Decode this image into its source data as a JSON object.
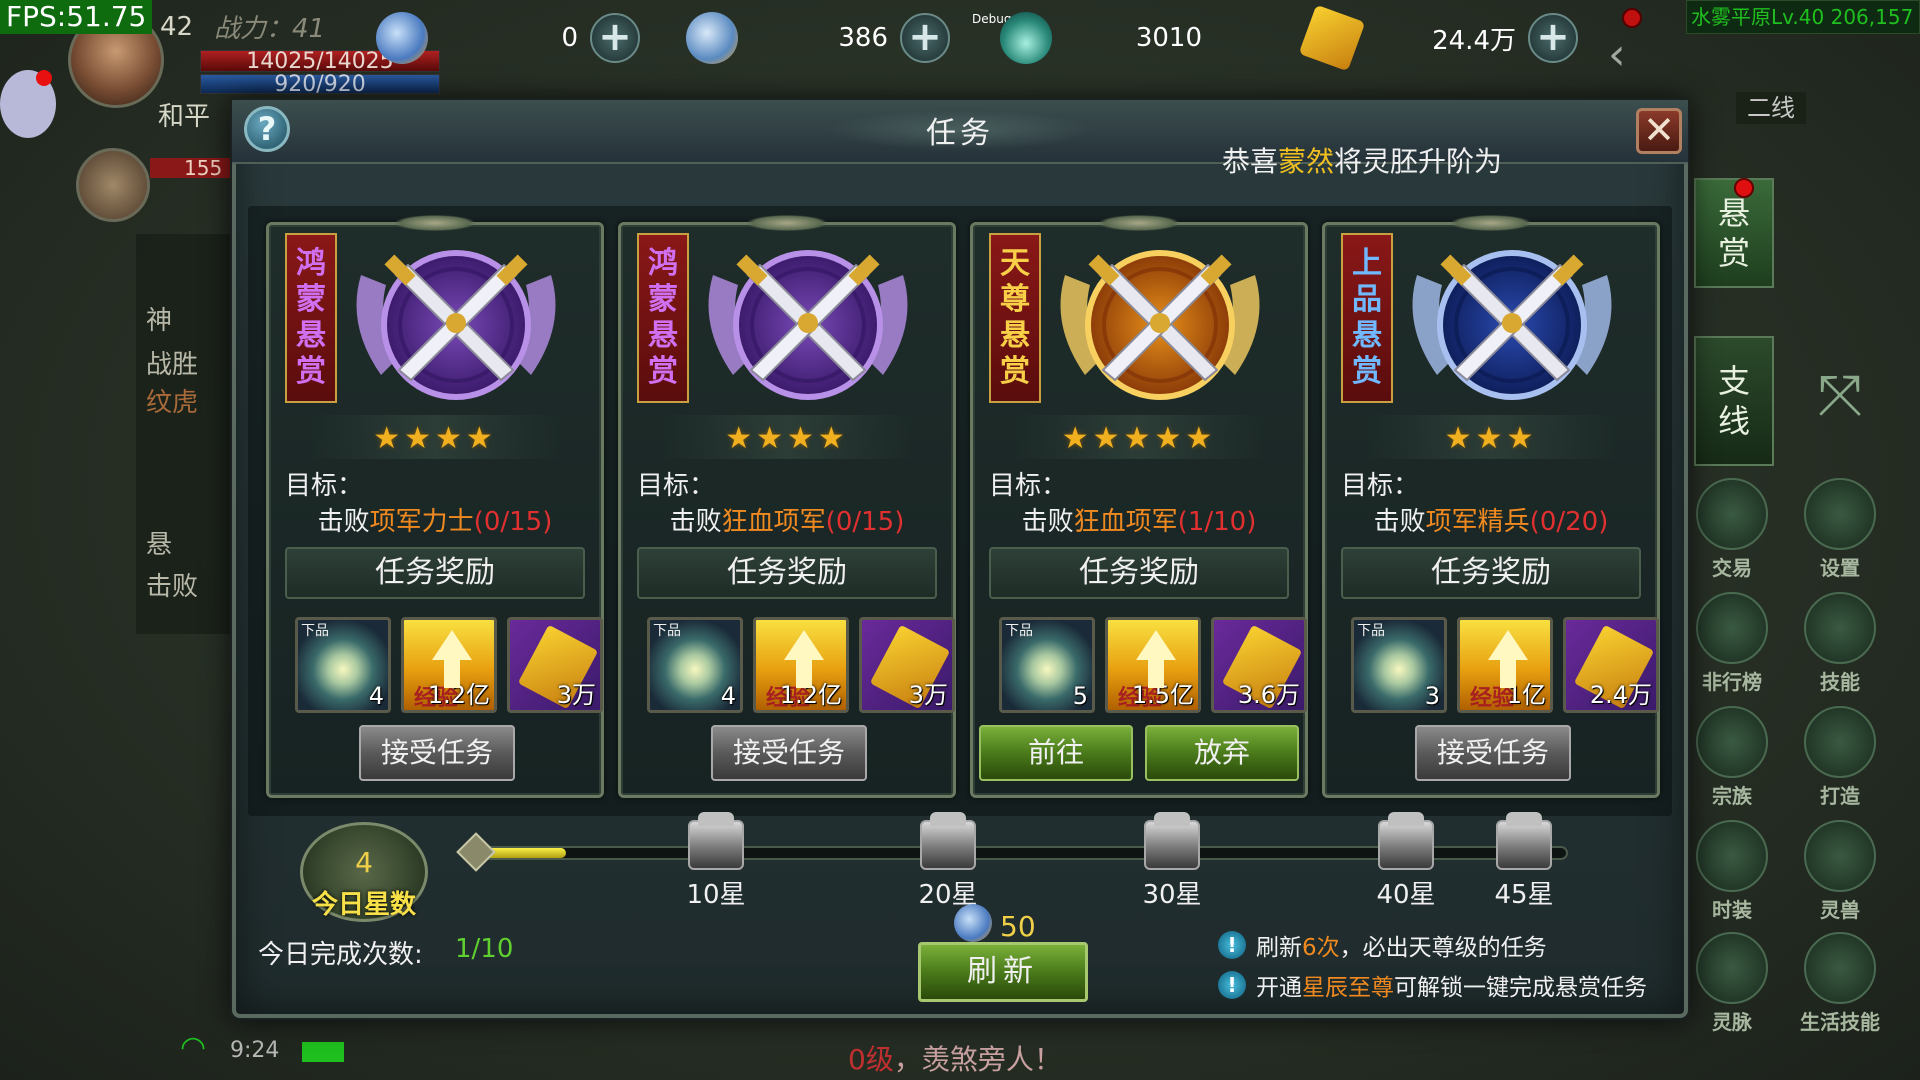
{
  "hud": {
    "fps": "FPS:51.75",
    "level": "42",
    "power": "战力：41",
    "hp": "14025/14025",
    "mp": "920/920",
    "mode": "和平",
    "pet_hp": "155",
    "map": "水雾平原Lv.40 206,157",
    "line": "二线",
    "debug": "Debug",
    "time": "9:24",
    "chat_level": "0级",
    "chat_text": "，羡煞旁人！",
    "currencies": [
      {
        "icon": "gold-ingot-icon",
        "value": "0"
      },
      {
        "icon": "bound-ingot-icon",
        "value": "386"
      },
      {
        "icon": "spirit-drop-icon",
        "value": "3010"
      },
      {
        "icon": "ticket-icon",
        "value": "24.4万"
      }
    ],
    "side_tabs": [
      "悬\n赏",
      "支\n线"
    ],
    "right_buttons": [
      {
        "name": "trade",
        "label": "交易"
      },
      {
        "name": "settings",
        "label": "设置"
      },
      {
        "name": "ranking",
        "label": "非行榜"
      },
      {
        "name": "skills",
        "label": "技能"
      },
      {
        "name": "clan",
        "label": "宗族"
      },
      {
        "name": "forge",
        "label": "打造"
      },
      {
        "name": "fashion",
        "label": "时装"
      },
      {
        "name": "spirit-beast",
        "label": "灵兽"
      },
      {
        "name": "meridian",
        "label": "灵脉"
      },
      {
        "name": "life-skill",
        "label": "生活技能"
      }
    ],
    "left_list": [
      "神",
      "战胜",
      "纹虎",
      "悬",
      "击败"
    ]
  },
  "dialog": {
    "title": "任务",
    "congrats_pre": "恭喜",
    "congrats_name": "蒙然",
    "congrats_post": "将灵胚升阶为",
    "goal_label": "目标：",
    "reward_header": "任务奖励",
    "cards": [
      {
        "banner": "鸿蒙悬赏",
        "tier": "purple",
        "stars": "★★★★",
        "goal_prefix": "击败",
        "goal_target": "项军力士",
        "goal_progress": "(0/15)",
        "rewards": [
          {
            "type": "orb",
            "quality": "下品",
            "count": "4"
          },
          {
            "type": "exp",
            "label": "经验",
            "count": "1.2亿"
          },
          {
            "type": "scroll",
            "count": "3万"
          }
        ],
        "buttons": [
          "接受任务"
        ]
      },
      {
        "banner": "鸿蒙悬赏",
        "tier": "purple",
        "stars": "★★★★",
        "goal_prefix": "击败",
        "goal_target": "狂血项军",
        "goal_progress": "(0/15)",
        "rewards": [
          {
            "type": "orb",
            "quality": "下品",
            "count": "4"
          },
          {
            "type": "exp",
            "label": "经验",
            "count": "1.2亿"
          },
          {
            "type": "scroll",
            "count": "3万"
          }
        ],
        "buttons": [
          "接受任务"
        ]
      },
      {
        "banner": "天尊悬赏",
        "tier": "gold",
        "stars": "★★★★★",
        "goal_prefix": "击败",
        "goal_target": "狂血项军",
        "goal_progress": "(1/10)",
        "rewards": [
          {
            "type": "orb",
            "quality": "下品",
            "count": "5"
          },
          {
            "type": "exp",
            "label": "经验",
            "count": "1.5亿"
          },
          {
            "type": "scroll",
            "count": "3.6万"
          }
        ],
        "buttons": [
          "前往",
          "放弃"
        ]
      },
      {
        "banner": "上品悬赏",
        "tier": "blue",
        "stars": "★★★",
        "goal_prefix": "击败",
        "goal_target": "项军精兵",
        "goal_progress": "(0/20)",
        "rewards": [
          {
            "type": "orb",
            "quality": "下品",
            "count": "3"
          },
          {
            "type": "exp",
            "label": "经验",
            "count": "1亿"
          },
          {
            "type": "scroll",
            "count": "2.4万"
          }
        ],
        "buttons": [
          "接受任务"
        ]
      }
    ],
    "daily_stars": "4",
    "daily_stars_label": "今日星数",
    "progress_fraction": 0.088,
    "milestones": [
      "10星",
      "20星",
      "30星",
      "40星",
      "45星"
    ],
    "completed_label": "今日完成次数:",
    "completed_value": "1/10",
    "refresh_cost": "50",
    "refresh_label": "刷新",
    "tip1_pre": "刷新",
    "tip1_hl": "6次",
    "tip1_post": "，必出天尊级的任务",
    "tip2_pre": "开通",
    "tip2_hl": "星辰至尊",
    "tip2_post": "可解锁一键完成悬赏任务"
  },
  "colors": {
    "accent_orange": "#f08a20",
    "progress_red": "#e03030",
    "gold": "#f0c020",
    "green": "#60d030"
  }
}
